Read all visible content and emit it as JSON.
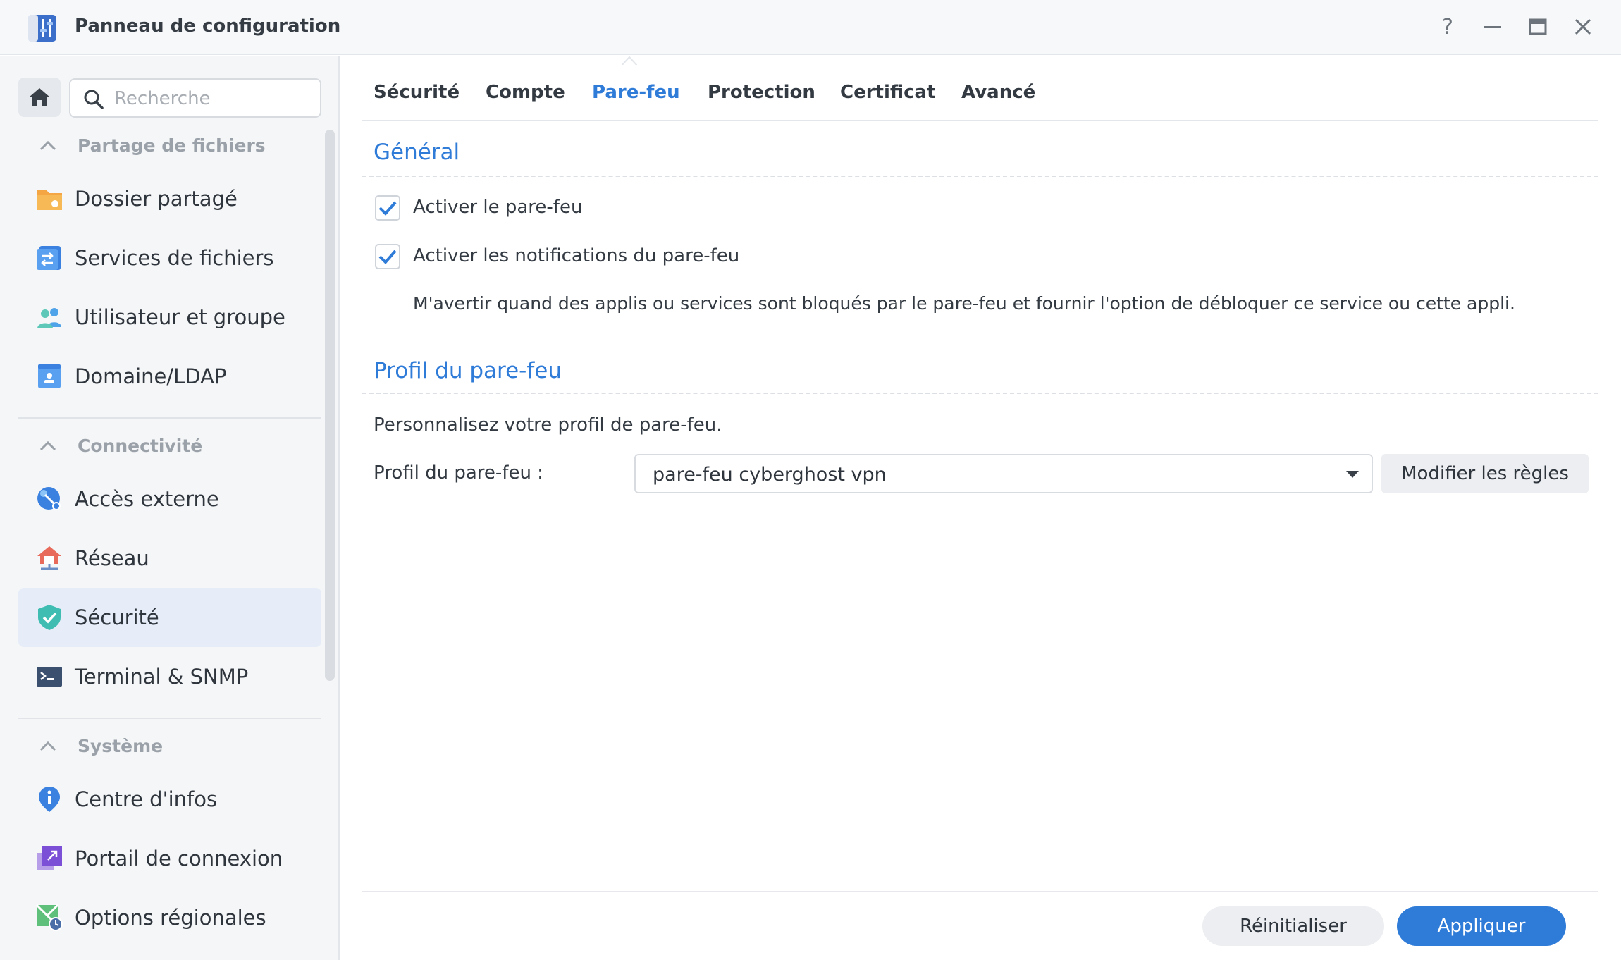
{
  "window": {
    "title": "Panneau de configuration",
    "help_label": "?"
  },
  "sidebar": {
    "search_placeholder": "Recherche",
    "groups": [
      {
        "label": "Partage de fichiers",
        "items": [
          {
            "label": "Dossier partagé",
            "icon": "folder-icon"
          },
          {
            "label": "Services de fichiers",
            "icon": "file-services-icon"
          },
          {
            "label": "Utilisateur et groupe",
            "icon": "users-icon"
          },
          {
            "label": "Domaine/LDAP",
            "icon": "domain-icon"
          }
        ]
      },
      {
        "label": "Connectivité",
        "items": [
          {
            "label": "Accès externe",
            "icon": "external-access-icon"
          },
          {
            "label": "Réseau",
            "icon": "network-icon"
          },
          {
            "label": "Sécurité",
            "icon": "shield-icon",
            "active": true
          },
          {
            "label": "Terminal & SNMP",
            "icon": "terminal-icon"
          }
        ]
      },
      {
        "label": "Système",
        "items": [
          {
            "label": "Centre d'infos",
            "icon": "info-icon"
          },
          {
            "label": "Portail de connexion",
            "icon": "login-portal-icon"
          },
          {
            "label": "Options régionales",
            "icon": "regional-options-icon"
          }
        ]
      }
    ]
  },
  "tabs": [
    {
      "label": "Sécurité"
    },
    {
      "label": "Compte"
    },
    {
      "label": "Pare-feu",
      "active": true
    },
    {
      "label": "Protection"
    },
    {
      "label": "Certificat"
    },
    {
      "label": "Avancé"
    }
  ],
  "general": {
    "title": "Général",
    "enable_firewall": {
      "label": "Activer le pare-feu",
      "checked": true
    },
    "enable_notifications": {
      "label": "Activer les notifications du pare-feu",
      "checked": true
    },
    "notification_description": "M'avertir quand des applis ou services sont bloqués par le pare-feu et fournir l'option de débloquer ce service ou cette appli."
  },
  "profile": {
    "title": "Profil du pare-feu",
    "description": "Personnalisez votre profil de pare-feu.",
    "field_label": "Profil du pare-feu :",
    "selected_value": "pare-feu cyberghost vpn",
    "edit_rules_label": "Modifier les règles"
  },
  "footer": {
    "reset_label": "Réinitialiser",
    "apply_label": "Appliquer"
  },
  "colors": {
    "accent": "#2f7bd8",
    "active_nav_bg": "#e6edf8"
  }
}
